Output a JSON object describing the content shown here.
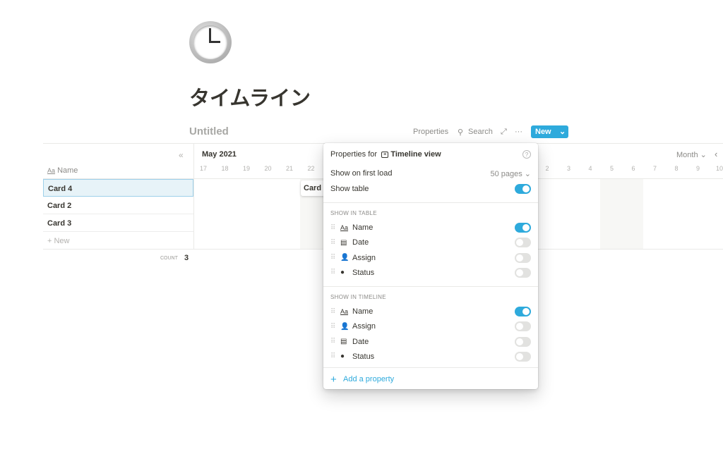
{
  "page": {
    "icon": "clock-icon",
    "title": "タイムライン"
  },
  "view": {
    "name": "Untitled",
    "properties": "Properties",
    "search": "Search",
    "new": "New"
  },
  "timeline": {
    "month": "May 2021",
    "scale": "Month",
    "days_left": [
      "17",
      "18",
      "19",
      "20",
      "21",
      "22"
    ],
    "days_right": [
      "2",
      "3",
      "4",
      "5",
      "6",
      "7",
      "8",
      "9",
      "10"
    ],
    "card_label": "Card"
  },
  "table": {
    "header": "Name",
    "rows": [
      "Card 4",
      "Card 2",
      "Card 3"
    ],
    "new": "New",
    "count_label": "COUNT",
    "count": "3"
  },
  "popup": {
    "title_prefix": "Properties for",
    "view_name": "Timeline view",
    "first_load_label": "Show on first load",
    "first_load_value": "50 pages",
    "show_table": "Show table",
    "show_table_on": true,
    "table_section": "SHOW IN TABLE",
    "table_props": [
      {
        "name": "Name",
        "icon": "text-icon",
        "on": true
      },
      {
        "name": "Date",
        "icon": "calendar-icon",
        "on": false
      },
      {
        "name": "Assign",
        "icon": "person-icon",
        "on": false
      },
      {
        "name": "Status",
        "icon": "status-icon",
        "on": false
      }
    ],
    "timeline_section": "SHOW IN TIMELINE",
    "timeline_props": [
      {
        "name": "Name",
        "icon": "text-icon",
        "on": true
      },
      {
        "name": "Assign",
        "icon": "person-icon",
        "on": false
      },
      {
        "name": "Date",
        "icon": "calendar-icon",
        "on": false
      },
      {
        "name": "Status",
        "icon": "status-icon",
        "on": false
      }
    ],
    "add": "Add a property"
  },
  "colors": {
    "accent": "#2eaadc"
  }
}
